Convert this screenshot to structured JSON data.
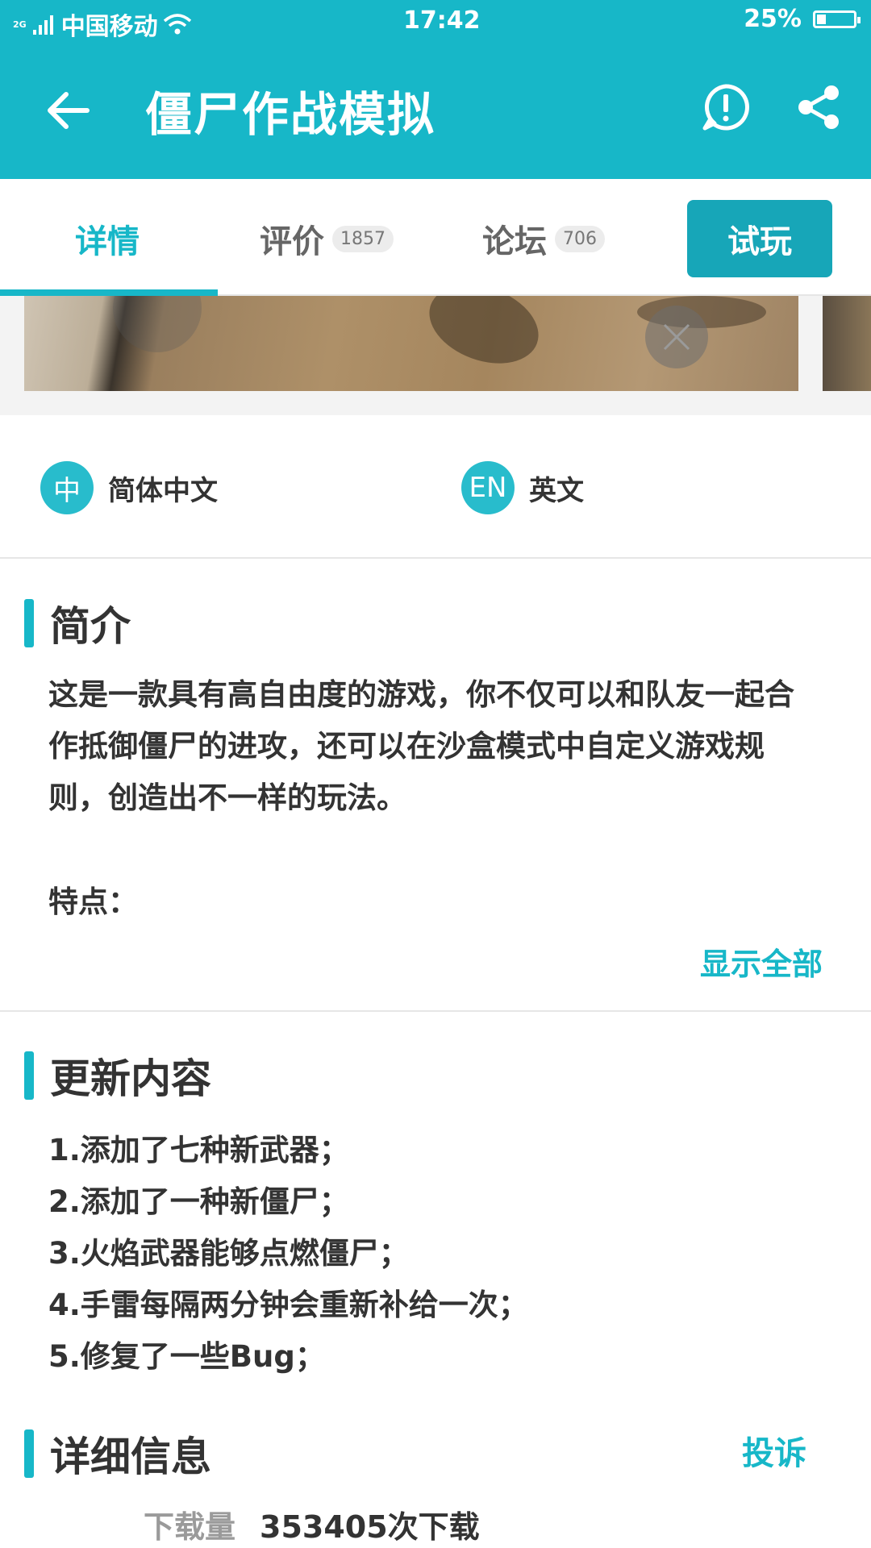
{
  "status_bar": {
    "network": "2G",
    "carrier": "中国移动",
    "time": "17:42",
    "battery": "25%",
    "battery_level": 0.25
  },
  "header": {
    "title": "僵尸作战模拟",
    "back_icon": "arrow-left-icon",
    "report_icon": "exclamation-circle-icon",
    "share_icon": "share-icon"
  },
  "tabs": [
    {
      "label": "详情",
      "badge": "",
      "active": true
    },
    {
      "label": "评价",
      "badge": "1857",
      "active": false
    },
    {
      "label": "论坛",
      "badge": "706",
      "active": false
    }
  ],
  "try_button": "试玩",
  "languages": [
    {
      "badge": "中",
      "label": "简体中文"
    },
    {
      "badge": "EN",
      "label": "英文"
    }
  ],
  "intro": {
    "title": "简介",
    "text": "这是一款具有高自由度的游戏，你不仅可以和队友一起合作抵御僵尸的进攻，还可以在沙盒模式中自定义游戏规则，创造出不一样的玩法。",
    "features_label": "特点：",
    "show_all": "显示全部"
  },
  "updates": {
    "title": "更新内容",
    "items": [
      "1.添加了七种新武器；",
      "2.添加了一种新僵尸；",
      "3.火焰武器能够点燃僵尸；",
      "4.手雷每隔两分钟会重新补给一次；",
      "5.修复了一些Bug；"
    ]
  },
  "details": {
    "title": "详细信息",
    "report": "投诉",
    "downloads_label": "下载量",
    "downloads_value": "353405次下载"
  }
}
